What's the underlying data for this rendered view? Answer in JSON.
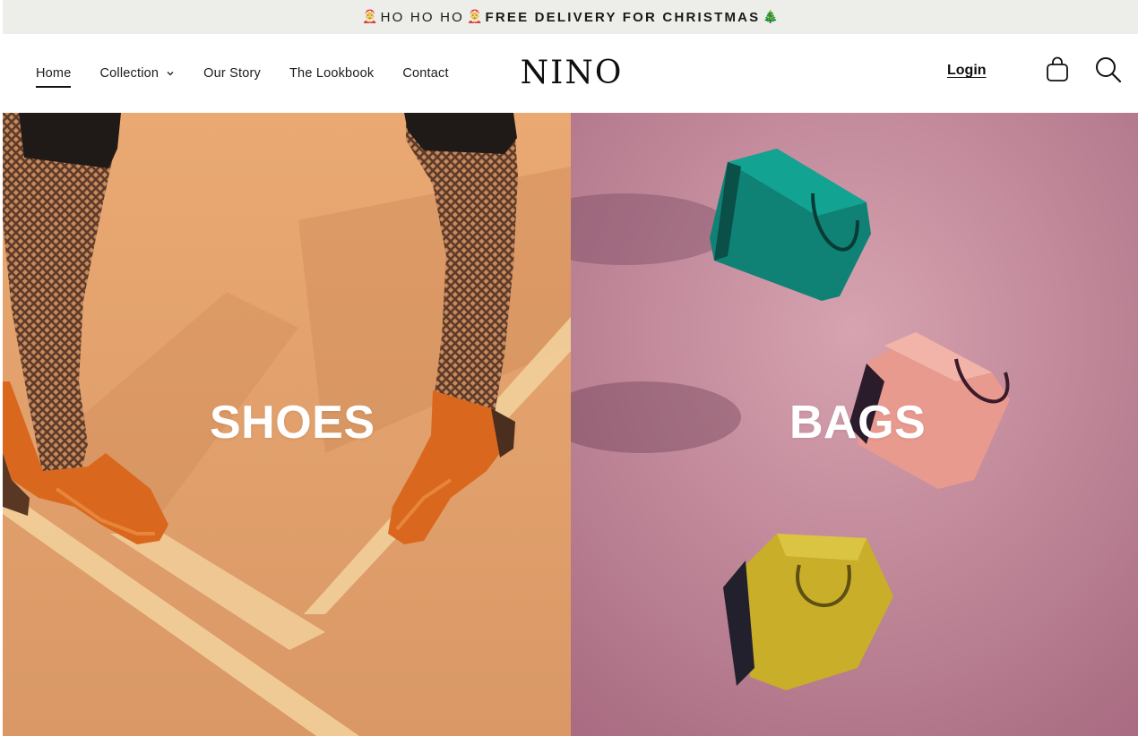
{
  "announcement": {
    "emoji_left": "🤶",
    "prefix": "HO HO HO",
    "emoji_mid": "🤶",
    "text": "FREE DELIVERY FOR CHRISTMAS",
    "emoji_right": "🎄"
  },
  "nav": {
    "items": [
      {
        "label": "Home",
        "active": true
      },
      {
        "label": "Collection",
        "has_dropdown": true
      },
      {
        "label": "Our Story"
      },
      {
        "label": "The Lookbook"
      },
      {
        "label": "Contact"
      }
    ]
  },
  "brand": {
    "logo_text": "NINO"
  },
  "header": {
    "login_label": "Login",
    "cart_icon": "shopping-bag-icon",
    "search_icon": "search-icon"
  },
  "hero": {
    "shoes_label": "SHOES",
    "bags_label": "BAGS"
  },
  "colors": {
    "announcement_bg": "#ededea",
    "shoes_bg": "#e3a26d",
    "bags_bg": "#bb8699",
    "text_dark": "#111111"
  }
}
